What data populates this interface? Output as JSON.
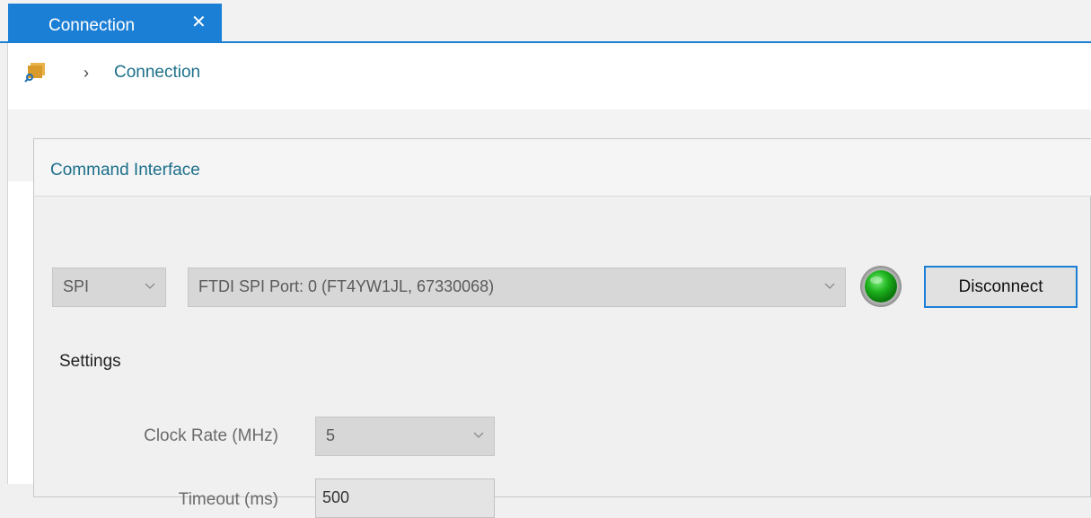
{
  "tabs": [
    {
      "label": "Connection",
      "close_glyph": "✕"
    }
  ],
  "breadcrumb": {
    "icon": "folder-icon",
    "separator": "›",
    "current": "Connection"
  },
  "command_interface": {
    "title": "Command Interface",
    "interface_select": {
      "value": "SPI"
    },
    "port_select": {
      "value": "FTDI SPI Port: 0 (FT4YW1JL, 67330068)"
    },
    "status": {
      "state": "connected",
      "color": "#1db21d"
    },
    "disconnect_label": "Disconnect"
  },
  "settings": {
    "title": "Settings",
    "clock_rate": {
      "label": "Clock Rate (MHz)",
      "value": "5"
    },
    "timeout": {
      "label": "Timeout (ms)",
      "value": "500"
    }
  },
  "colors": {
    "accent": "#1c7fd6",
    "link": "#1b6f8a"
  }
}
